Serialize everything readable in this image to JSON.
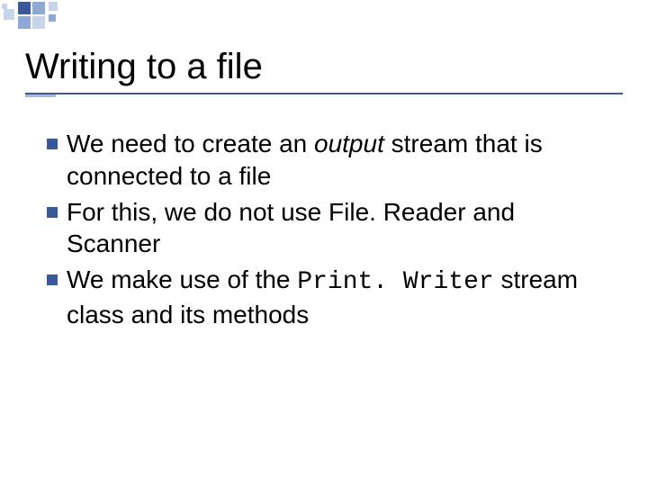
{
  "slide": {
    "title": "Writing to a file",
    "bullets": [
      {
        "pre": "We need to create an ",
        "em": "output",
        "post": " stream that is connected to a file"
      },
      {
        "text": "For this, we do not use File. Reader and Scanner"
      },
      {
        "pre": "We make use of the ",
        "code": "Print. Writer",
        "post": " stream class and its methods"
      }
    ]
  }
}
